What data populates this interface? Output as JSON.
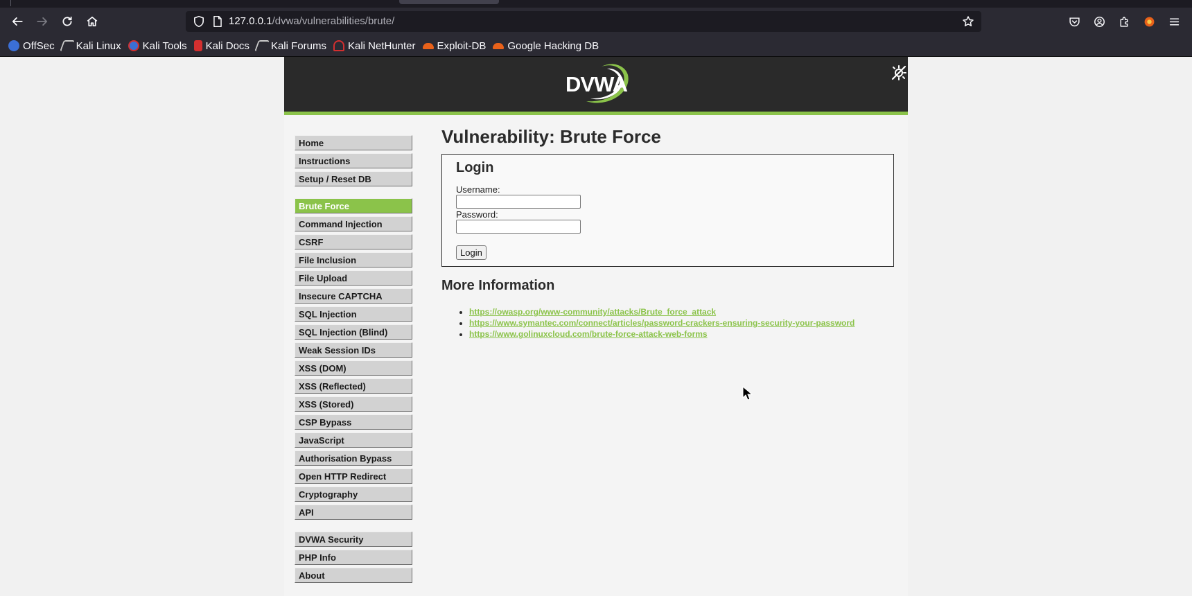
{
  "browser": {
    "url_host": "127.0.0.1",
    "url_path": "/dvwa/vulnerabilities/brute/",
    "bookmarks": [
      {
        "label": "OffSec",
        "icon": "offsec-icon",
        "color": "#3b6fd6"
      },
      {
        "label": "Kali Linux",
        "icon": "kali-dragon-icon",
        "color": "#cccccc"
      },
      {
        "label": "Kali Tools",
        "icon": "kali-tools-icon",
        "color": "#3b6fd6"
      },
      {
        "label": "Kali Docs",
        "icon": "kali-docs-icon",
        "color": "#d32f2f"
      },
      {
        "label": "Kali Forums",
        "icon": "kali-dragon-icon",
        "color": "#cccccc"
      },
      {
        "label": "Kali NetHunter",
        "icon": "nethunter-icon",
        "color": "#d32f2f"
      },
      {
        "label": "Exploit-DB",
        "icon": "exploit-db-icon",
        "color": "#e8611a"
      },
      {
        "label": "Google Hacking DB",
        "icon": "ghdb-icon",
        "color": "#e8611a"
      }
    ]
  },
  "header": {
    "logo_text": "DVWA",
    "accent_color": "#8bc34a"
  },
  "menu": {
    "groups": [
      [
        "Home",
        "Instructions",
        "Setup / Reset DB"
      ],
      [
        "Brute Force",
        "Command Injection",
        "CSRF",
        "File Inclusion",
        "File Upload",
        "Insecure CAPTCHA",
        "SQL Injection",
        "SQL Injection (Blind)",
        "Weak Session IDs",
        "XSS (DOM)",
        "XSS (Reflected)",
        "XSS (Stored)",
        "CSP Bypass",
        "JavaScript",
        "Authorisation Bypass",
        "Open HTTP Redirect",
        "Cryptography",
        "API"
      ],
      [
        "DVWA Security",
        "PHP Info",
        "About"
      ]
    ],
    "active": "Brute Force"
  },
  "main": {
    "title": "Vulnerability: Brute Force",
    "login": {
      "heading": "Login",
      "username_label": "Username:",
      "username_value": "",
      "password_label": "Password:",
      "password_value": "",
      "submit_label": "Login"
    },
    "more_info_heading": "More Information",
    "links": [
      "https://owasp.org/www-community/attacks/Brute_force_attack",
      "https://www.symantec.com/connect/articles/password-crackers-ensuring-security-your-password",
      "https://www.golinuxcloud.com/brute-force-attack-web-forms"
    ]
  }
}
